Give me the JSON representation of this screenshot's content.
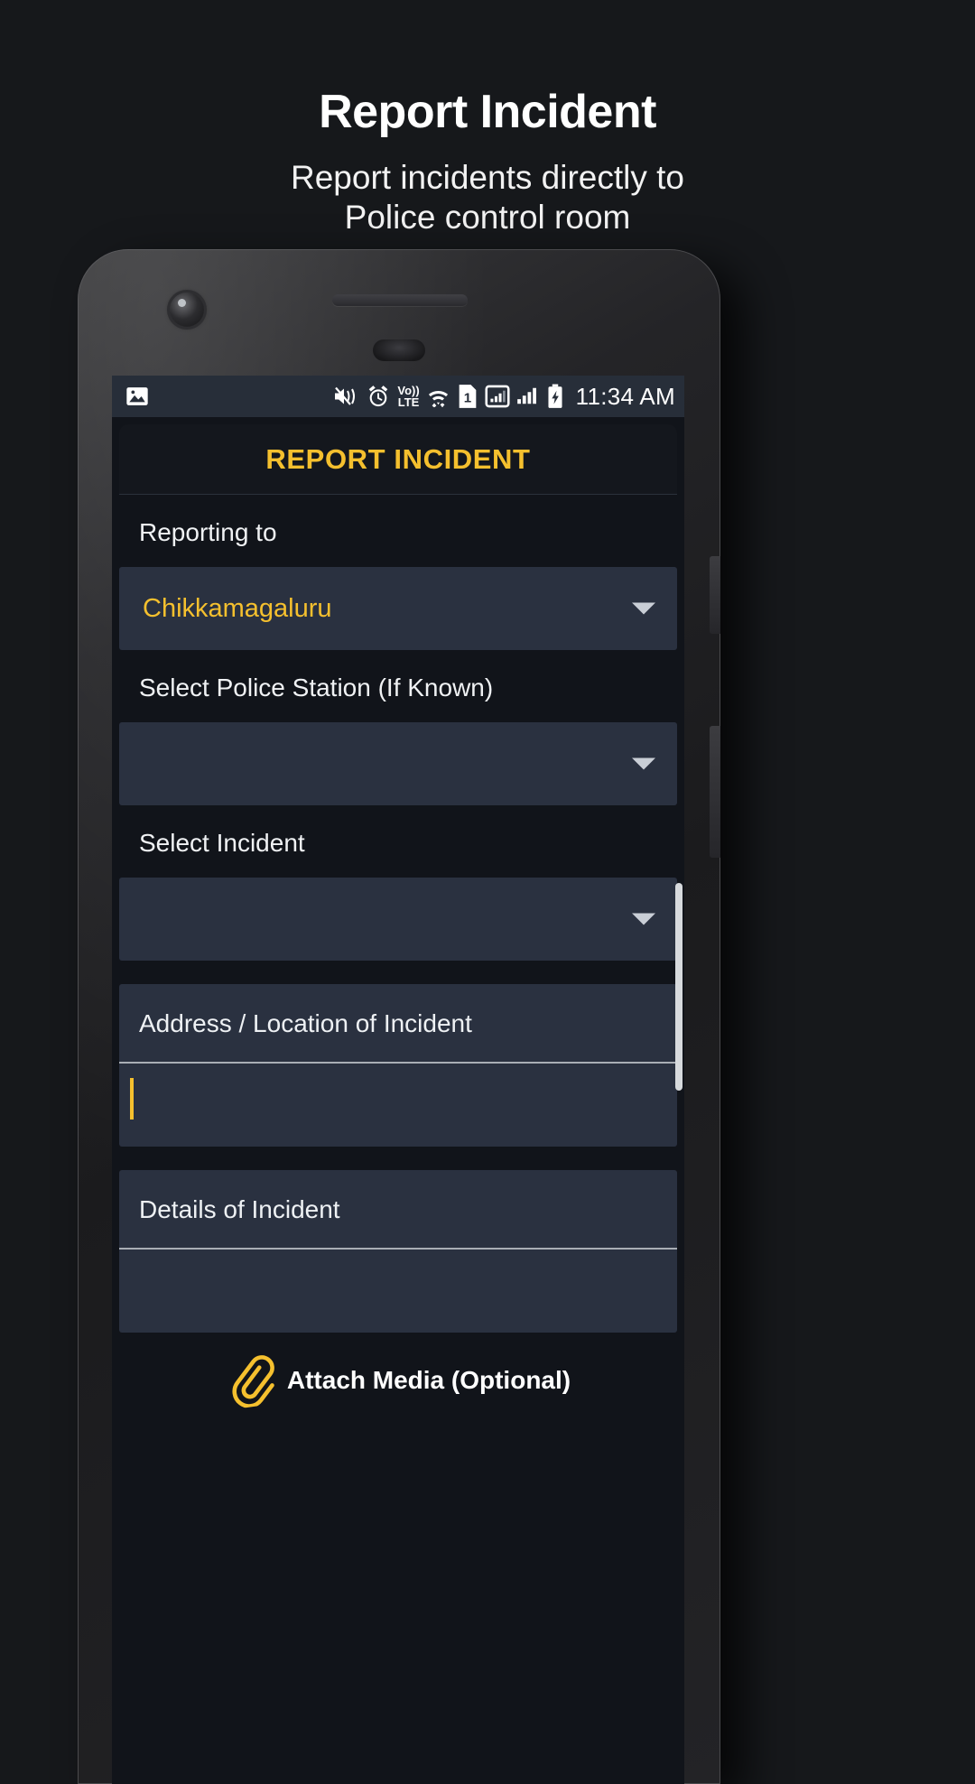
{
  "promo": {
    "title": "Report Incident",
    "subtitle_line1": "Report incidents directly to",
    "subtitle_line2": "Police control room"
  },
  "colors": {
    "page_background": "#16181b",
    "accent_yellow": "#f5c02e",
    "field_background": "#2a3140",
    "screen_background": "#11141a",
    "statusbar_background": "#272e39",
    "text_primary": "#ffffff"
  },
  "phone": {
    "statusbar": {
      "time": "11:34 AM",
      "left_icons": [
        "image-icon"
      ],
      "right_icons": [
        "mute-vibrate-icon",
        "alarm-icon",
        "volte-icon",
        "wifi-icon",
        "sim-1-icon",
        "signal-bars-sim1-icon",
        "signal-bars-sim2-icon",
        "battery-charging-icon"
      ],
      "volte_label_top": "Vo))",
      "volte_label_bottom": "LTE",
      "sim_label": "1"
    },
    "app": {
      "title": "REPORT INCIDENT",
      "fields": {
        "reporting_to": {
          "label": "Reporting to",
          "value": "Chikkamagaluru",
          "icon": "chevron-down-icon"
        },
        "police_station": {
          "label": "Select Police Station (If Known)",
          "value": "",
          "icon": "chevron-down-icon"
        },
        "incident": {
          "label": "Select Incident",
          "value": "",
          "icon": "chevron-down-icon"
        },
        "address": {
          "label": "Address / Location of Incident",
          "value": ""
        },
        "details": {
          "label": "Details of Incident",
          "value": ""
        }
      },
      "attach": {
        "label": "Attach Media (Optional)",
        "icon": "paperclip-icon"
      }
    }
  }
}
